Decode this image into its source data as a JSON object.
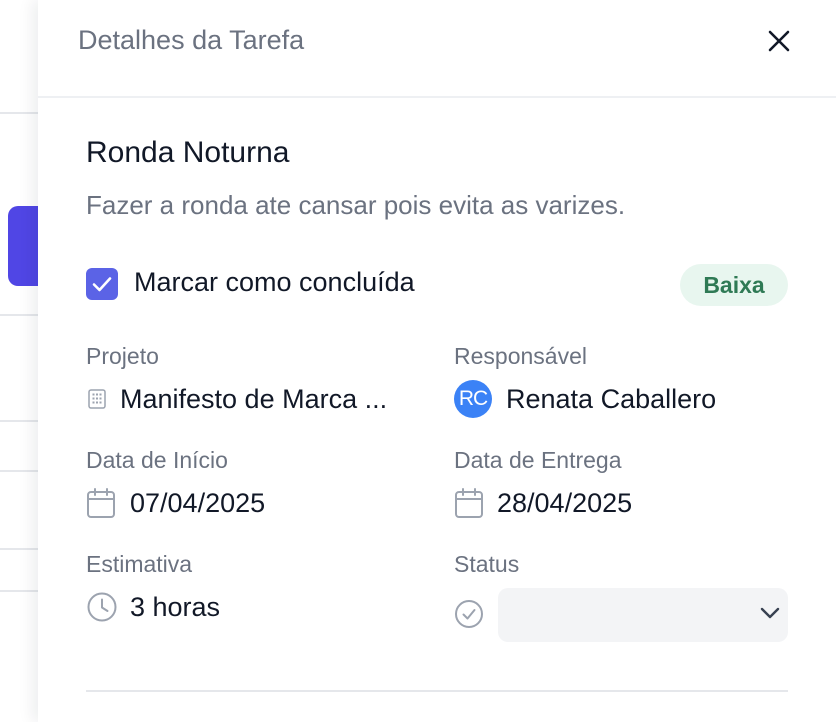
{
  "panel": {
    "title": "Detalhes da Tarefa"
  },
  "task": {
    "title": "Ronda Noturna",
    "description": "Fazer a ronda ate cansar pois evita as varizes.",
    "complete_label": "Marcar como concluída",
    "completed": true,
    "priority": "Baixa"
  },
  "fields": {
    "project": {
      "label": "Projeto",
      "value": "Manifesto de Marca ..."
    },
    "assignee": {
      "label": "Responsável",
      "initials": "RC",
      "value": "Renata Caballero"
    },
    "start_date": {
      "label": "Data de Início",
      "value": "07/04/2025"
    },
    "due_date": {
      "label": "Data de Entrega",
      "value": "28/04/2025"
    },
    "estimate": {
      "label": "Estimativa",
      "value": "3 horas"
    },
    "status": {
      "label": "Status",
      "value": ""
    }
  },
  "colors": {
    "accent": "#5b63e6",
    "badge_bg": "#e8f6ef",
    "badge_text": "#2f7a55",
    "avatar": "#3b82f6"
  },
  "icons": {
    "close": "close-icon",
    "check": "check-icon",
    "project": "building-icon",
    "calendar": "calendar-icon",
    "clock": "clock-icon",
    "status": "check-circle-icon",
    "dropdown": "chevron-down-icon"
  }
}
